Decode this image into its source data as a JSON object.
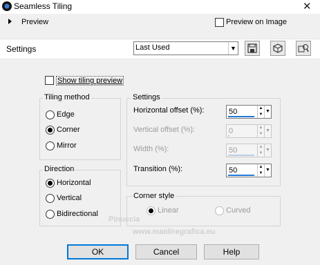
{
  "window": {
    "title": "Seamless Tiling",
    "close_glyph": "✕"
  },
  "preview": {
    "label": "Preview",
    "preview_on_image_label": "Preview on Image",
    "preview_on_image_checked": false
  },
  "settings_bar": {
    "label": "Settings",
    "preset_value": "Last Used",
    "icons": [
      "save-icon",
      "randomize-icon",
      "preset-manage-icon"
    ]
  },
  "show_tiling_preview": {
    "label": "Show tiling preview",
    "checked": false
  },
  "tiling_method": {
    "title": "Tiling method",
    "options": [
      "Edge",
      "Corner",
      "Mirror"
    ],
    "selected": "Corner"
  },
  "direction": {
    "title": "Direction",
    "options": [
      "Horizontal",
      "Vertical",
      "Bidirectional"
    ],
    "selected": "Horizontal"
  },
  "settings_group": {
    "title": "Settings",
    "horizontal_offset": {
      "label": "Horizontal offset (%):",
      "value": "50",
      "enabled": true
    },
    "vertical_offset": {
      "label": "Vertical offset (%):",
      "value": "0",
      "enabled": false
    },
    "width": {
      "label": "Width (%):",
      "value": "50",
      "enabled": false
    },
    "transition": {
      "label": "Transition (%):",
      "value": "50",
      "enabled": true
    }
  },
  "corner_style": {
    "title": "Corner style",
    "options": [
      "Linear",
      "Curved"
    ],
    "selected": "Linear",
    "enabled": false
  },
  "buttons": {
    "ok": "OK",
    "cancel": "Cancel",
    "help": "Help"
  },
  "watermark": {
    "line1": "Pinuccia",
    "line2": "www.maidiregrafica.eu"
  },
  "colors": {
    "accent": "#0078d7",
    "spin_bar": "#1e78d7"
  }
}
